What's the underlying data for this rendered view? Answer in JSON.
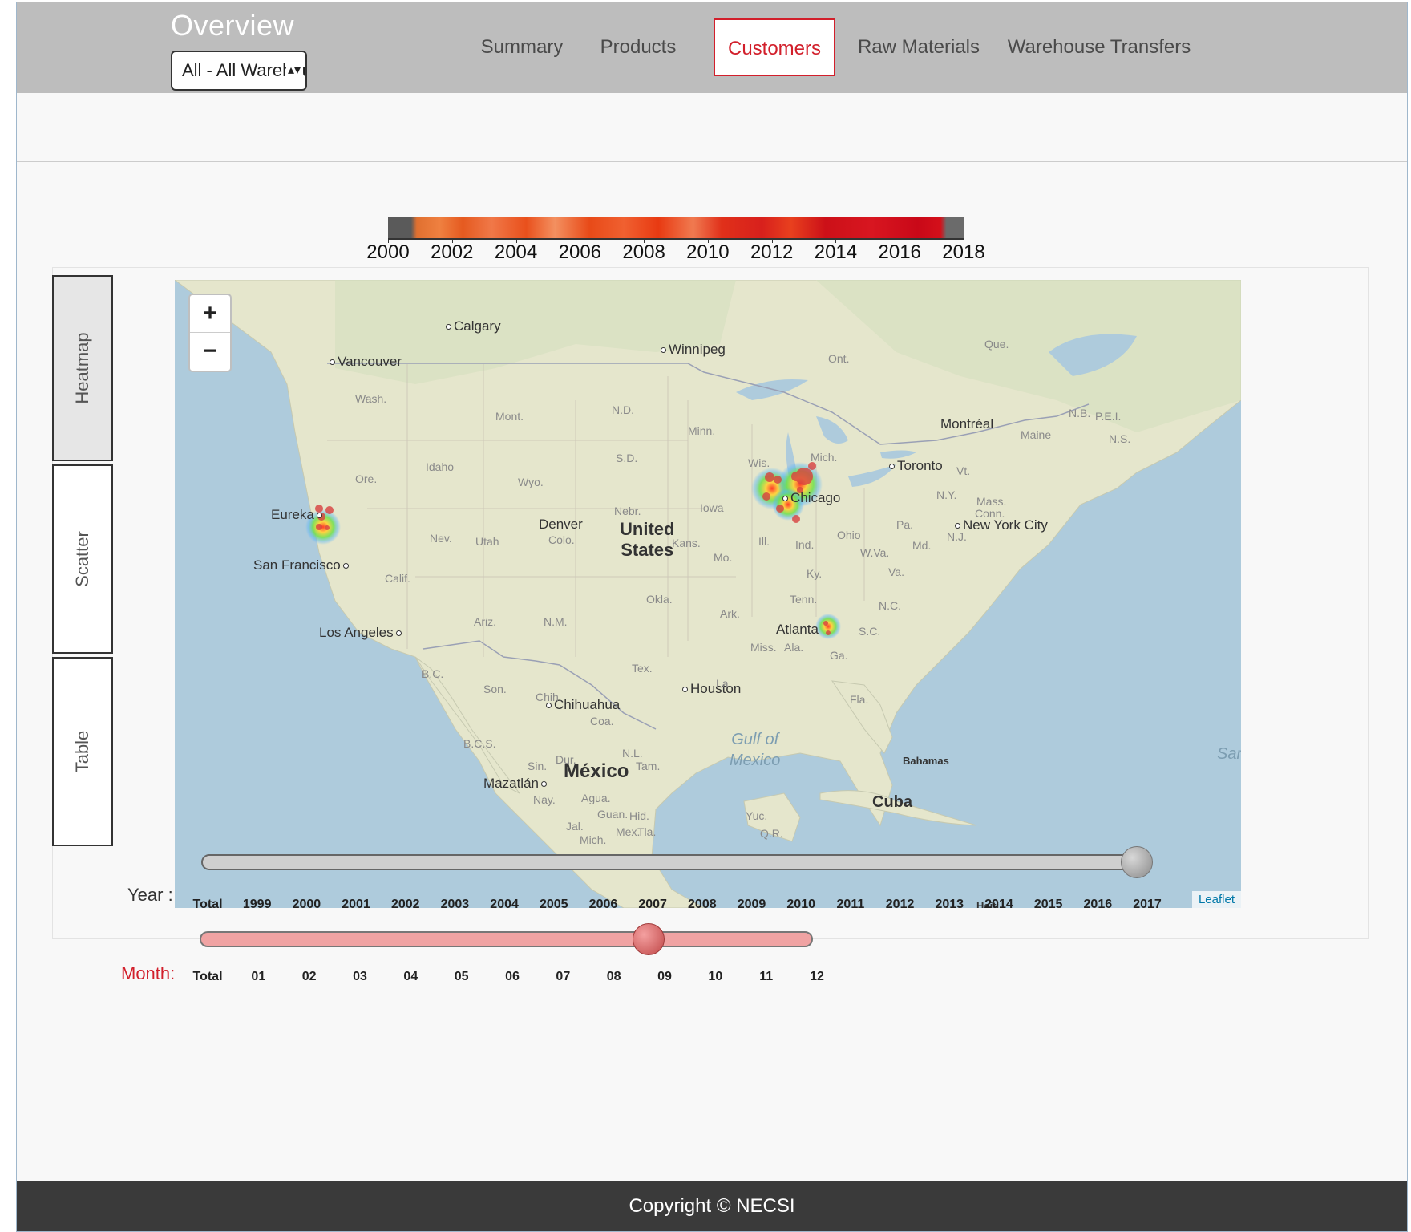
{
  "header": {
    "title": "Overview",
    "warehouse_select": {
      "value": "All - All Warehouses",
      "arrows": "▴▾"
    },
    "tabs": [
      {
        "label": "Summary",
        "active": false
      },
      {
        "label": "Products",
        "active": false
      },
      {
        "label": "Customers",
        "active": true
      },
      {
        "label": "Raw Materials",
        "active": false
      },
      {
        "label": "Warehouse Transfers",
        "active": false
      }
    ]
  },
  "colorbar": {
    "ticks": [
      "2000",
      "2002",
      "2004",
      "2006",
      "2008",
      "2010",
      "2012",
      "2014",
      "2016",
      "2018"
    ]
  },
  "view_tabs": [
    {
      "label": "Heatmap",
      "active": true
    },
    {
      "label": "Scatter",
      "active": false
    },
    {
      "label": "Table",
      "active": false
    }
  ],
  "map": {
    "zoom_in": "+",
    "zoom_out": "−",
    "attribution": "Leaflet",
    "cities": [
      "Calgary",
      "Winnipeg",
      "Vancouver",
      "Montréal",
      "Toronto",
      "Chicago",
      "New York City",
      "Eureka",
      "San Francisco",
      "Denver",
      "Los Angeles",
      "Atlanta",
      "Houston",
      "Chihuahua",
      "Mazatlán"
    ],
    "countries": {
      "us_line1": "United",
      "us_line2": "States",
      "mexico": "México",
      "cuba": "Cuba",
      "bahamas": "Bahamas",
      "haiti": "Haiti"
    },
    "water": {
      "gulf_line1": "Gulf of",
      "gulf_line2": "Mexico",
      "sargasso": "Sar"
    },
    "states": [
      "Wash.",
      "Ore.",
      "Idaho",
      "Mont.",
      "Wyo.",
      "N.D.",
      "S.D.",
      "Nebr.",
      "Minn.",
      "Iowa",
      "Wis.",
      "Mich.",
      "Ill.",
      "Ind.",
      "Ohio",
      "Pa.",
      "N.Y.",
      "Vt.",
      "Mass.",
      "Conn.",
      "N.J.",
      "Md.",
      "W.Va.",
      "Va.",
      "Ky.",
      "Tenn.",
      "N.C.",
      "S.C.",
      "Ga.",
      "Ala.",
      "Miss.",
      "Ark.",
      "La.",
      "Okla.",
      "Tex.",
      "Kans.",
      "Mo.",
      "Colo.",
      "Utah",
      "Nev.",
      "Calif.",
      "Ariz.",
      "N.M.",
      "Ont.",
      "Que.",
      "N.B.",
      "P.E.I.",
      "N.S.",
      "Maine",
      "Fla.",
      "B.C.",
      "Son.",
      "Chih.",
      "Coa.",
      "B.C.S.",
      "Sin.",
      "Dur.",
      "N.L.",
      "Tam.",
      "Nay.",
      "Agua.",
      "Guan.",
      "Hid.",
      "Jal.",
      "Mich.",
      "Mex.",
      "Tla.",
      "Yuc.",
      "Q.R."
    ]
  },
  "year_slider": {
    "label": "Year :",
    "value": "2017",
    "ticks": [
      "Total",
      "1999",
      "2000",
      "2001",
      "2002",
      "2003",
      "2004",
      "2005",
      "2006",
      "2007",
      "2008",
      "2009",
      "2010",
      "2011",
      "2012",
      "2013",
      "2014",
      "2015",
      "2016",
      "2017"
    ]
  },
  "month_slider": {
    "label": "Month:",
    "value": "09",
    "ticks": [
      "Total",
      "01",
      "02",
      "03",
      "04",
      "05",
      "06",
      "07",
      "08",
      "09",
      "10",
      "11",
      "12"
    ]
  },
  "footer": {
    "text": "Copyright © NECSI"
  },
  "colors": {
    "accent": "#d21f2b",
    "header": "#bdbdbd",
    "footer": "#3a3a3a"
  }
}
